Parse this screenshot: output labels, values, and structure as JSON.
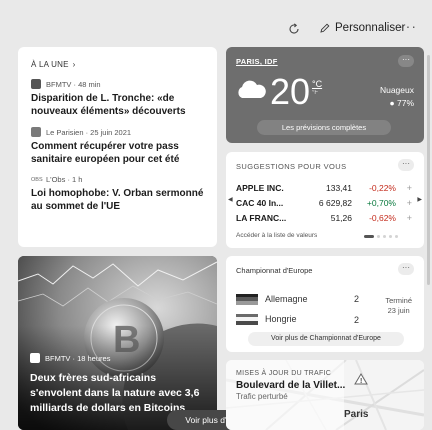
{
  "toolbar": {
    "refresh_icon": "refresh-icon",
    "personalize_label": "Personnaliser",
    "more_label": "···"
  },
  "news": {
    "section_label": "À LA UNE",
    "items": [
      {
        "source": "BFMTV · 48 min",
        "title": "Disparition de L. Tronche: «de nouveaux éléments» découverts"
      },
      {
        "source": "Le Parisien · 25 juin 2021",
        "title": "Comment récupérer votre pass sanitaire européen pour cet été"
      },
      {
        "source": "L'Obs · 1 h",
        "title": "Loi homophobe: V. Orban sermonné au sommet de l'UE"
      }
    ],
    "obs_logo": "OBS"
  },
  "weather": {
    "location": "PARIS, IDF",
    "temperature": "20",
    "unit_c": "°C",
    "unit_f": "°F",
    "condition": "Nuageux",
    "humidity": "77%",
    "forecast_label": "Les prévisions complètes",
    "more_label": "···"
  },
  "stocks": {
    "header": "SUGGESTIONS POUR VOUS",
    "more_label": "···",
    "rows": [
      {
        "name": "APPLE INC.",
        "value": "133,41",
        "change": "-0,22%",
        "direction": "down"
      },
      {
        "name": "CAC 40 In...",
        "value": "6 629,82",
        "change": "+0,70%",
        "direction": "up"
      },
      {
        "name": "LA FRANC...",
        "value": "51,26",
        "change": "-0,62%",
        "direction": "down"
      }
    ],
    "add_label": "+",
    "link_label": "Accéder à la liste de valeurs",
    "nav_prev": "◀",
    "nav_next": "▶",
    "colors": {
      "up": "#0a7a3e",
      "down": "#c42b1c"
    }
  },
  "photo_news": {
    "source": "BFMTV · 18 heures",
    "headline": "Deux frères sud-africains s'envolent dans la nature avec 3,6 milliards de dollars en Bitcoins"
  },
  "see_more_news_label": "Voir plus d'actualités  ›",
  "football": {
    "title": "Championnat d'Europe",
    "more_label": "···",
    "teams": [
      {
        "name": "Allemagne",
        "score": "2"
      },
      {
        "name": "Hongrie",
        "score": "2"
      }
    ],
    "status_line1": "Terminé",
    "status_line2": "23 juin",
    "button_label": "Voir plus de Championnat d'Europe"
  },
  "traffic": {
    "header": "MISES À JOUR DU TRAFIC",
    "road": "Boulevard de la Villet...",
    "status": "Trafic perturbé",
    "city": "Paris"
  }
}
